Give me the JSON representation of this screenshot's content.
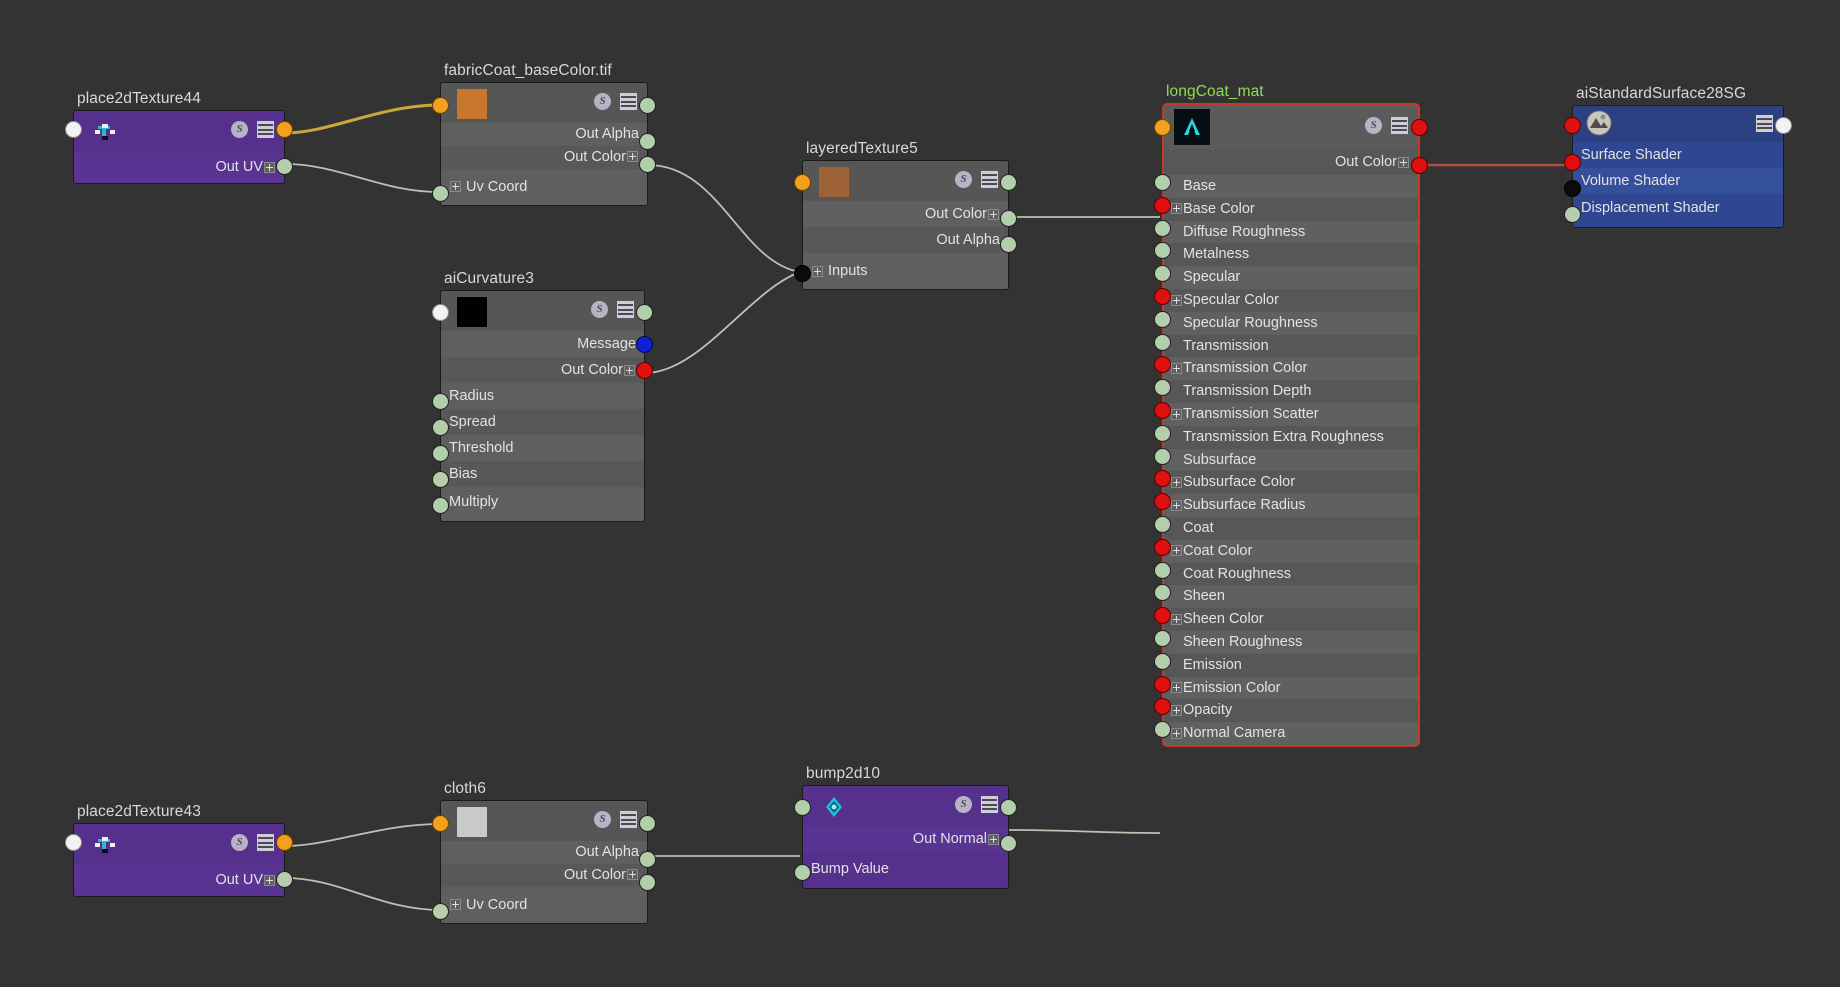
{
  "canvas": {
    "background": "#333333",
    "app": "hypershade-node-editor"
  },
  "colors": {
    "wire_default": "#b9c3b0",
    "wire_uv": "#c8a83a",
    "wire_shader": "#b34a44",
    "node_purple": "#5a3492",
    "node_gray": "#5f5f5f",
    "node_blue": "#34509c",
    "selected_border": "#c43a28",
    "selected_title": "#8fdc55",
    "port_green": "#b3ceaa",
    "port_orange": "#f2a01e",
    "port_red": "#e01010",
    "port_blue": "#1020d8",
    "port_white": "#f2f2f2",
    "port_black": "#0b0b0b"
  },
  "nodes": {
    "place2dTexture44": {
      "title": "place2dTexture44",
      "type": "place2dTexture",
      "buttons": {
        "s": "S",
        "lines": "attribute-list"
      },
      "rows": [
        {
          "label": "Out UV",
          "side": "right",
          "expand": true
        }
      ]
    },
    "fabricCoat_baseColor": {
      "title": "fabricCoat_baseColor.tif",
      "type": "file",
      "buttons": {
        "s": "S",
        "lines": "attribute-list"
      },
      "rows": [
        {
          "label": "Out Alpha",
          "side": "right",
          "expand": false
        },
        {
          "label": "Out Color",
          "side": "right",
          "expand": true
        },
        {
          "label": "Uv Coord",
          "side": "left",
          "expand": true
        }
      ]
    },
    "aiCurvature3": {
      "title": "aiCurvature3",
      "type": "aiCurvature",
      "buttons": {
        "s": "S",
        "lines": "attribute-list"
      },
      "rows": [
        {
          "label": "Message",
          "side": "right",
          "expand": false
        },
        {
          "label": "Out Color",
          "side": "right",
          "expand": true
        },
        {
          "label": "Radius",
          "side": "left",
          "expand": false
        },
        {
          "label": "Spread",
          "side": "left",
          "expand": false
        },
        {
          "label": "Threshold",
          "side": "left",
          "expand": false
        },
        {
          "label": "Bias",
          "side": "left",
          "expand": false
        },
        {
          "label": "Multiply",
          "side": "left",
          "expand": false
        }
      ]
    },
    "layeredTexture5": {
      "title": "layeredTexture5",
      "type": "layeredTexture",
      "buttons": {
        "s": "S",
        "lines": "attribute-list"
      },
      "rows": [
        {
          "label": "Out Color",
          "side": "right",
          "expand": true
        },
        {
          "label": "Out Alpha",
          "side": "right",
          "expand": false
        },
        {
          "label": "Inputs",
          "side": "left",
          "expand": true
        }
      ]
    },
    "longCoat_mat": {
      "title": "longCoat_mat",
      "type": "aiStandardSurface",
      "selected": true,
      "buttons": {
        "s": "S",
        "lines": "attribute-list"
      },
      "out_rows": [
        {
          "label": "Out Color",
          "side": "right",
          "expand": true
        }
      ],
      "attributes": [
        {
          "label": "Base",
          "port": "green",
          "expand": false
        },
        {
          "label": "Base Color",
          "port": "red",
          "expand": true
        },
        {
          "label": "Diffuse Roughness",
          "port": "green",
          "expand": false
        },
        {
          "label": "Metalness",
          "port": "green",
          "expand": false
        },
        {
          "label": "Specular",
          "port": "green",
          "expand": false
        },
        {
          "label": "Specular Color",
          "port": "red",
          "expand": true
        },
        {
          "label": "Specular Roughness",
          "port": "green",
          "expand": false
        },
        {
          "label": "Transmission",
          "port": "green",
          "expand": false
        },
        {
          "label": "Transmission Color",
          "port": "red",
          "expand": true
        },
        {
          "label": "Transmission Depth",
          "port": "green",
          "expand": false
        },
        {
          "label": "Transmission Scatter",
          "port": "red",
          "expand": true
        },
        {
          "label": "Transmission Extra Roughness",
          "port": "green",
          "expand": false
        },
        {
          "label": "Subsurface",
          "port": "green",
          "expand": false
        },
        {
          "label": "Subsurface Color",
          "port": "red",
          "expand": true
        },
        {
          "label": "Subsurface Radius",
          "port": "red",
          "expand": true
        },
        {
          "label": "Coat",
          "port": "green",
          "expand": false
        },
        {
          "label": "Coat Color",
          "port": "red",
          "expand": true
        },
        {
          "label": "Coat Roughness",
          "port": "green",
          "expand": false
        },
        {
          "label": "Sheen",
          "port": "green",
          "expand": false
        },
        {
          "label": "Sheen Color",
          "port": "red",
          "expand": true
        },
        {
          "label": "Sheen Roughness",
          "port": "green",
          "expand": false
        },
        {
          "label": "Emission",
          "port": "green",
          "expand": false
        },
        {
          "label": "Emission Color",
          "port": "red",
          "expand": true
        },
        {
          "label": "Opacity",
          "port": "red",
          "expand": true
        },
        {
          "label": "Normal Camera",
          "port": "green",
          "expand": true
        }
      ]
    },
    "aiStandardSurface28SG": {
      "title": "aiStandardSurface28SG",
      "type": "shadingEngine",
      "buttons": {
        "lines": "attribute-list"
      },
      "rows": [
        {
          "label": "Surface Shader",
          "port": "red"
        },
        {
          "label": "Volume Shader",
          "port": "black"
        },
        {
          "label": "Displacement Shader",
          "port": "green"
        }
      ]
    },
    "place2dTexture43": {
      "title": "place2dTexture43",
      "type": "place2dTexture",
      "buttons": {
        "s": "S",
        "lines": "attribute-list"
      },
      "rows": [
        {
          "label": "Out UV",
          "side": "right",
          "expand": true
        }
      ]
    },
    "cloth6": {
      "title": "cloth6",
      "type": "cloth",
      "buttons": {
        "s": "S",
        "lines": "attribute-list"
      },
      "rows": [
        {
          "label": "Out Alpha",
          "side": "right",
          "expand": false
        },
        {
          "label": "Out Color",
          "side": "right",
          "expand": true
        },
        {
          "label": "Uv Coord",
          "side": "left",
          "expand": true
        }
      ]
    },
    "bump2d10": {
      "title": "bump2d10",
      "type": "bump2d",
      "buttons": {
        "s": "S",
        "lines": "attribute-list"
      },
      "rows": [
        {
          "label": "Out Normal",
          "side": "right",
          "expand": true
        },
        {
          "label": "Bump Value",
          "side": "left",
          "expand": false
        }
      ]
    }
  },
  "connections": [
    {
      "from": "place2dTexture44.out",
      "to": "fabricCoat_baseColor.in",
      "color": "#c8a83a"
    },
    {
      "from": "place2dTexture44.outUV",
      "to": "fabricCoat_baseColor.uvCoord",
      "color": "#b9c3b0"
    },
    {
      "from": "fabricCoat_baseColor.outColor",
      "to": "layeredTexture5.inputs",
      "color": "#b9c3b0"
    },
    {
      "from": "aiCurvature3.outColor",
      "to": "layeredTexture5.inputs",
      "color": "#b9c3b0"
    },
    {
      "from": "layeredTexture5.outColor",
      "to": "longCoat_mat.baseColor",
      "color": "#b9c3b0"
    },
    {
      "from": "longCoat_mat.outColor",
      "to": "aiStandardSurface28SG.surfaceShader",
      "color": "#b34a44"
    },
    {
      "from": "place2dTexture43.out",
      "to": "cloth6.in",
      "color": "#b9c3b0"
    },
    {
      "from": "place2dTexture43.outUV",
      "to": "cloth6.uvCoord",
      "color": "#b9c3b0"
    },
    {
      "from": "cloth6.outAlpha",
      "to": "bump2d10.bumpValue",
      "color": "#b9c3b0"
    },
    {
      "from": "bump2d10.outNormal",
      "to": "longCoat_mat.normalCamera",
      "color": "#b9c3b0"
    }
  ]
}
